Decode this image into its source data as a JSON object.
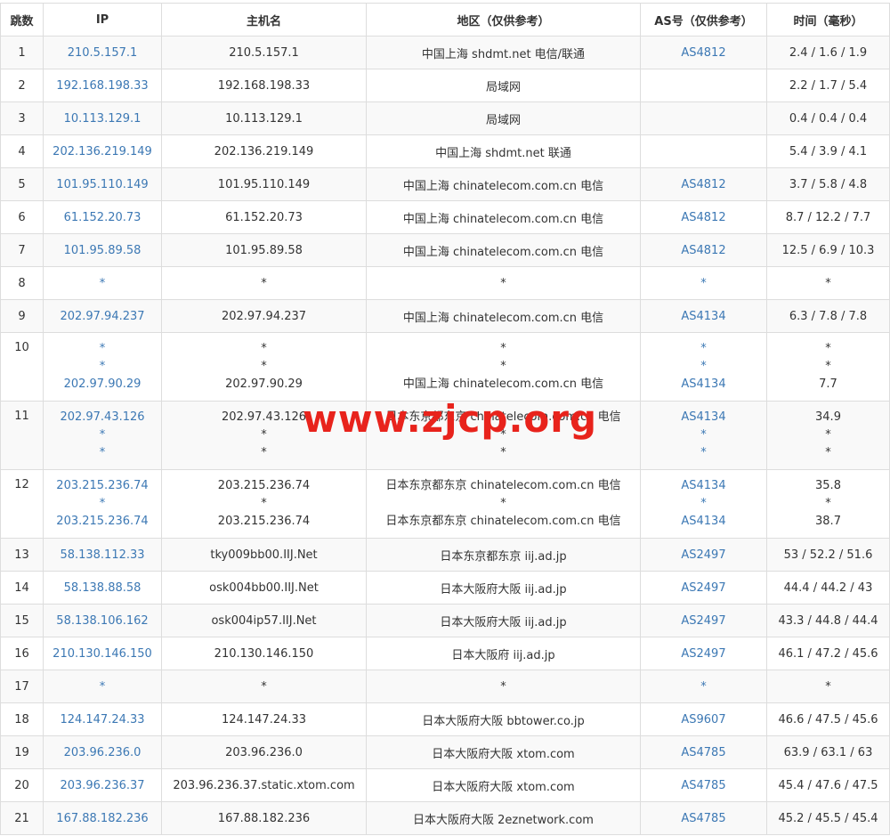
{
  "columns": [
    "跳数",
    "IP",
    "主机名",
    "地区（仅供参考）",
    "AS号（仅供参考）",
    "时间（毫秒）"
  ],
  "rows": [
    {
      "hop": "1",
      "ip": [
        "210.5.157.1"
      ],
      "host": [
        "210.5.157.1"
      ],
      "geo": [
        "中国上海 shdmt.net 电信/联通"
      ],
      "asn": [
        "AS4812"
      ],
      "time": [
        "2.4 / 1.6 / 1.9"
      ]
    },
    {
      "hop": "2",
      "ip": [
        "192.168.198.33"
      ],
      "host": [
        "192.168.198.33"
      ],
      "geo": [
        "局域网"
      ],
      "asn": [
        ""
      ],
      "time": [
        "2.2 / 1.7 / 5.4"
      ]
    },
    {
      "hop": "3",
      "ip": [
        "10.113.129.1"
      ],
      "host": [
        "10.113.129.1"
      ],
      "geo": [
        "局域网"
      ],
      "asn": [
        ""
      ],
      "time": [
        "0.4 / 0.4 / 0.4"
      ]
    },
    {
      "hop": "4",
      "ip": [
        "202.136.219.149"
      ],
      "host": [
        "202.136.219.149"
      ],
      "geo": [
        "中国上海 shdmt.net 联通"
      ],
      "asn": [
        ""
      ],
      "time": [
        "5.4 / 3.9 / 4.1"
      ]
    },
    {
      "hop": "5",
      "ip": [
        "101.95.110.149"
      ],
      "host": [
        "101.95.110.149"
      ],
      "geo": [
        "中国上海 chinatelecom.com.cn 电信"
      ],
      "asn": [
        "AS4812"
      ],
      "time": [
        "3.7 / 5.8 / 4.8"
      ]
    },
    {
      "hop": "6",
      "ip": [
        "61.152.20.73"
      ],
      "host": [
        "61.152.20.73"
      ],
      "geo": [
        "中国上海 chinatelecom.com.cn 电信"
      ],
      "asn": [
        "AS4812"
      ],
      "time": [
        "8.7 / 12.2 / 7.7"
      ]
    },
    {
      "hop": "7",
      "ip": [
        "101.95.89.58"
      ],
      "host": [
        "101.95.89.58"
      ],
      "geo": [
        "中国上海 chinatelecom.com.cn 电信"
      ],
      "asn": [
        "AS4812"
      ],
      "time": [
        "12.5 / 6.9 / 10.3"
      ]
    },
    {
      "hop": "8",
      "ip": [
        "*"
      ],
      "host": [
        "*"
      ],
      "geo": [
        "*"
      ],
      "asn": [
        "*"
      ],
      "time": [
        "*"
      ]
    },
    {
      "hop": "9",
      "ip": [
        "202.97.94.237"
      ],
      "host": [
        "202.97.94.237"
      ],
      "geo": [
        "中国上海 chinatelecom.com.cn 电信"
      ],
      "asn": [
        "AS4134"
      ],
      "time": [
        "6.3 / 7.8 / 7.8"
      ]
    },
    {
      "hop": "10",
      "ip": [
        "*",
        "*",
        "202.97.90.29"
      ],
      "host": [
        "*",
        "*",
        "202.97.90.29"
      ],
      "geo": [
        "*",
        "*",
        "中国上海 chinatelecom.com.cn 电信"
      ],
      "asn": [
        "*",
        "*",
        "AS4134"
      ],
      "time": [
        "*",
        "*",
        "7.7"
      ]
    },
    {
      "hop": "11",
      "ip": [
        "202.97.43.126",
        "*",
        "*"
      ],
      "host": [
        "202.97.43.126",
        "*",
        "*"
      ],
      "geo": [
        "日本东京都东京 chinatelecom.com.cn 电信",
        "*",
        "*"
      ],
      "asn": [
        "AS4134",
        "*",
        "*"
      ],
      "time": [
        "34.9",
        "*",
        "*"
      ]
    },
    {
      "hop": "12",
      "ip": [
        "203.215.236.74",
        "*",
        "203.215.236.74"
      ],
      "host": [
        "203.215.236.74",
        "*",
        "203.215.236.74"
      ],
      "geo": [
        "日本东京都东京 chinatelecom.com.cn 电信",
        "*",
        "日本东京都东京 chinatelecom.com.cn 电信"
      ],
      "asn": [
        "AS4134",
        "*",
        "AS4134"
      ],
      "time": [
        "35.8",
        "*",
        "38.7"
      ]
    },
    {
      "hop": "13",
      "ip": [
        "58.138.112.33"
      ],
      "host": [
        "tky009bb00.IIJ.Net"
      ],
      "geo": [
        "日本东京都东京 iij.ad.jp"
      ],
      "asn": [
        "AS2497"
      ],
      "time": [
        "53 / 52.2 / 51.6"
      ]
    },
    {
      "hop": "14",
      "ip": [
        "58.138.88.58"
      ],
      "host": [
        "osk004bb00.IIJ.Net"
      ],
      "geo": [
        "日本大阪府大阪 iij.ad.jp"
      ],
      "asn": [
        "AS2497"
      ],
      "time": [
        "44.4 / 44.2 / 43"
      ]
    },
    {
      "hop": "15",
      "ip": [
        "58.138.106.162"
      ],
      "host": [
        "osk004ip57.IIJ.Net"
      ],
      "geo": [
        "日本大阪府大阪 iij.ad.jp"
      ],
      "asn": [
        "AS2497"
      ],
      "time": [
        "43.3 / 44.8 / 44.4"
      ]
    },
    {
      "hop": "16",
      "ip": [
        "210.130.146.150"
      ],
      "host": [
        "210.130.146.150"
      ],
      "geo": [
        "日本大阪府 iij.ad.jp"
      ],
      "asn": [
        "AS2497"
      ],
      "time": [
        "46.1 / 47.2 / 45.6"
      ]
    },
    {
      "hop": "17",
      "ip": [
        "*"
      ],
      "host": [
        "*"
      ],
      "geo": [
        "*"
      ],
      "asn": [
        "*"
      ],
      "time": [
        "*"
      ]
    },
    {
      "hop": "18",
      "ip": [
        "124.147.24.33"
      ],
      "host": [
        "124.147.24.33"
      ],
      "geo": [
        "日本大阪府大阪 bbtower.co.jp"
      ],
      "asn": [
        "AS9607"
      ],
      "time": [
        "46.6 / 47.5 / 45.6"
      ]
    },
    {
      "hop": "19",
      "ip": [
        "203.96.236.0"
      ],
      "host": [
        "203.96.236.0"
      ],
      "geo": [
        "日本大阪府大阪 xtom.com"
      ],
      "asn": [
        "AS4785"
      ],
      "time": [
        "63.9 / 63.1 / 63"
      ]
    },
    {
      "hop": "20",
      "ip": [
        "203.96.236.37"
      ],
      "host": [
        "203.96.236.37.static.xtom.com"
      ],
      "geo": [
        "日本大阪府大阪 xtom.com"
      ],
      "asn": [
        "AS4785"
      ],
      "time": [
        "45.4 / 47.6 / 47.5"
      ]
    },
    {
      "hop": "21",
      "ip": [
        "167.88.182.236"
      ],
      "host": [
        "167.88.182.236"
      ],
      "geo": [
        "日本大阪府大阪 2eznetwork.com"
      ],
      "asn": [
        "AS4785"
      ],
      "time": [
        "45.2 / 45.5 / 45.4"
      ]
    }
  ],
  "watermark": "www.zjcp.org",
  "colors": {
    "link": "#3c78b4",
    "watermark": "#e8231c",
    "border": "#dddddd",
    "stripe": "#f9f9f9"
  }
}
